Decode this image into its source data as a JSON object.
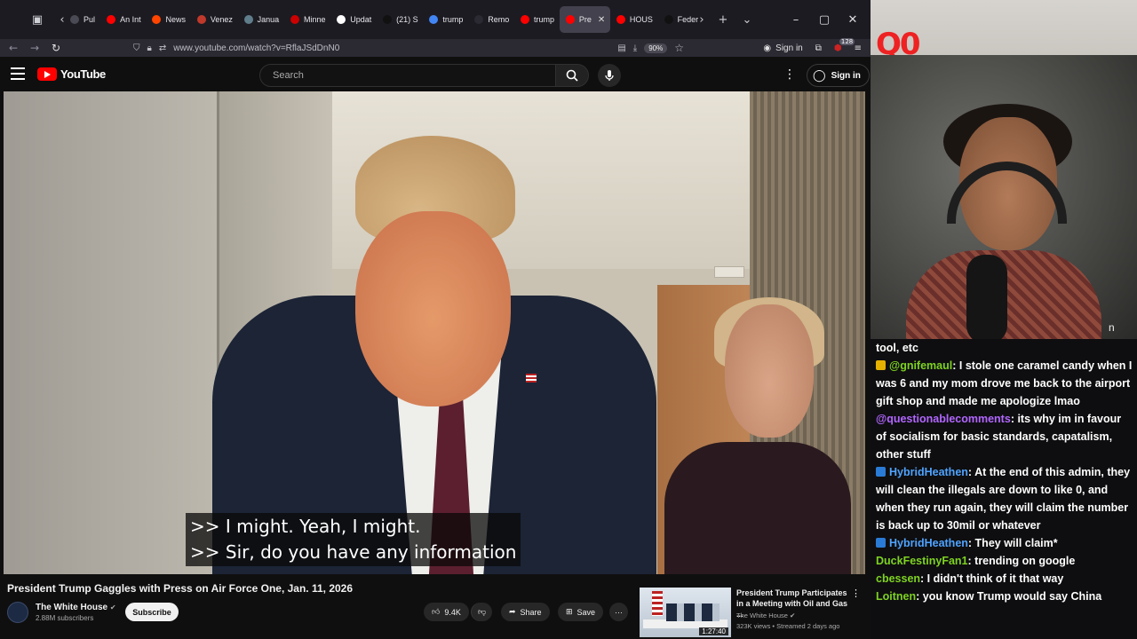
{
  "browser": {
    "tabs": [
      {
        "label": "Pul",
        "color": "#4a4a55"
      },
      {
        "label": "An Int",
        "color": "#ff0000"
      },
      {
        "label": "News",
        "color": "#ff4500"
      },
      {
        "label": "Venez",
        "color": "#c0392b"
      },
      {
        "label": "Janua",
        "color": "#607d8b"
      },
      {
        "label": "Minne",
        "color": "#cc0000"
      },
      {
        "label": "Updat",
        "color": "#ffffff"
      },
      {
        "label": "(21) S",
        "color": "#111111"
      },
      {
        "label": "trump",
        "color": "#4285f4"
      },
      {
        "label": "Remo",
        "color": "#2b2a33"
      },
      {
        "label": "trump",
        "color": "#ff0000"
      },
      {
        "label": "Pre",
        "color": "#ff0000",
        "active": true
      },
      {
        "label": "HOUS",
        "color": "#ff0000"
      },
      {
        "label": "Feder",
        "color": "#111111"
      }
    ],
    "url": "www.youtube.com/watch?v=RflaJSdDnN0",
    "zoom": "90%",
    "sign_in": "Sign in",
    "notif_count": "128"
  },
  "youtube": {
    "logo": "YouTube",
    "search_placeholder": "Search",
    "sign_in": "Sign in",
    "caption_line1": ">> I might. Yeah, I might.",
    "caption_line2": ">> Sir, do you have any information",
    "video_title": "President Trump Gaggles with Press on Air Force One, Jan. 11, 2026",
    "channel": "The White House",
    "subscribers": "2.88M subscribers",
    "subscribe": "Subscribe",
    "likes": "9.4K",
    "share": "Share",
    "save": "Save",
    "rec": {
      "title": "President Trump Participates in a Meeting with Oil and Gas ...",
      "channel": "The White House",
      "meta": "323K views • Streamed 2 days ago",
      "duration": "1:27:40"
    }
  },
  "stream": {
    "overlay_logo": "Q0",
    "cam_text": "n"
  },
  "chat": {
    "messages": [
      {
        "user": "",
        "text": "tool, etc",
        "color": "#ffffff",
        "icon": ""
      },
      {
        "user": "@gnifemaul",
        "text": ": I stole one caramel candy when I was 6 and my mom drove me back to the airport gift shop and made me apologize lmao",
        "color": "#7ed321",
        "icon": "#e5b100"
      },
      {
        "user": "@questionablecomments",
        "text": ": its why im in favour of socialism for basic standards, capatalism, other stuff",
        "color": "#b266ff",
        "icon": ""
      },
      {
        "user": "HybridHeathen",
        "text": ": At the end of this admin, they will clean the illegals are down to like 0, and when they run again, they will claim the number is back up to 30mil or whatever",
        "color": "#4fa3ff",
        "icon": "#2a7bd6"
      },
      {
        "user": "HybridHeathen",
        "text": ": They will claim*",
        "color": "#4fa3ff",
        "icon": "#2a7bd6"
      },
      {
        "user": "DuckFestinyFan1",
        "text": ": trending on google",
        "color": "#7ed321",
        "icon": ""
      },
      {
        "user": "cbessen",
        "text": ": I didn't think of it that way",
        "color": "#7ed321",
        "icon": ""
      },
      {
        "user": "Loitnen",
        "text": ": you know Trump would say China",
        "color": "#7ed321",
        "icon": ""
      }
    ]
  }
}
